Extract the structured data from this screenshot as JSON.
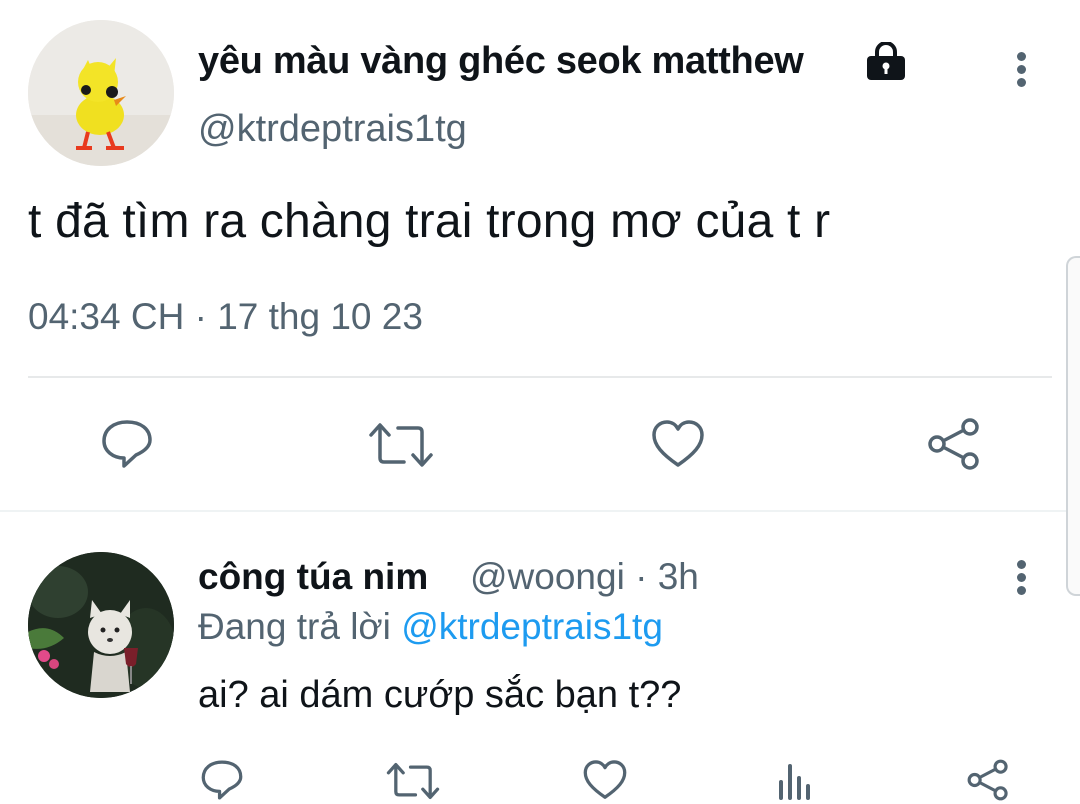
{
  "main_tweet": {
    "display_name": "yêu màu vàng ghéc seok matthew",
    "locked_icon": "lock-icon",
    "handle": "@ktrdeptrais1tg",
    "text": "t đã tìm ra chàng trai trong mơ của t r",
    "time": "04:34 CH",
    "separator": "·",
    "date": "17 thg 10 23",
    "actions": [
      "reply-icon",
      "retweet-icon",
      "like-icon",
      "share-icon"
    ]
  },
  "reply_tweet": {
    "display_name": "công túa nim",
    "handle": "@woongi",
    "separator": "·",
    "age": "3h",
    "replying_prefix": "Đang trả lời",
    "replying_to": "@ktrdeptrais1tg",
    "text": "ai? ai dám cướp sắc bạn t??",
    "actions": [
      "reply-icon",
      "retweet-icon",
      "like-icon",
      "views-icon",
      "share-icon"
    ]
  },
  "colors": {
    "text": "#0f1419",
    "secondary": "#536471",
    "link": "#1d9bf0",
    "divider": "#e7e9ea"
  }
}
